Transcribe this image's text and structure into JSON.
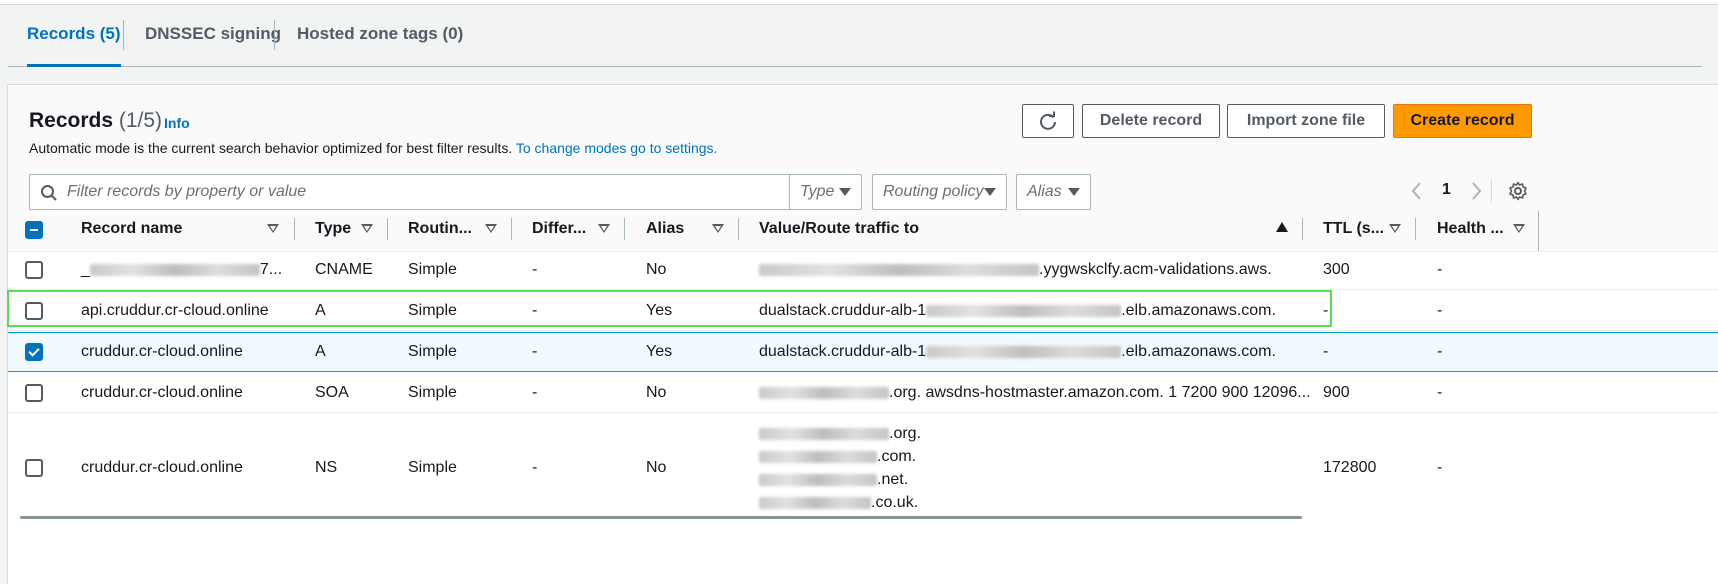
{
  "tabs": [
    {
      "label": "Records (5)"
    },
    {
      "label": "DNSSEC signing"
    },
    {
      "label": "Hosted zone tags (0)"
    }
  ],
  "header": {
    "title": "Records",
    "count": "(1/5)",
    "info": "Info",
    "description": "Automatic mode is the current search behavior optimized for best filter results.",
    "description_link": "To change modes go to settings."
  },
  "buttons": {
    "delete": "Delete record",
    "import": "Import zone file",
    "create": "Create record"
  },
  "filters": {
    "search_placeholder": "Filter records by property or value",
    "type": "Type",
    "routing_policy": "Routing policy",
    "alias": "Alias"
  },
  "pagination": {
    "page": "1"
  },
  "columns": {
    "record_name": "Record name",
    "type": "Type",
    "routing": "Routin...",
    "differ": "Differ...",
    "alias": "Alias",
    "value": "Value/Route traffic to",
    "ttl": "TTL (s...",
    "health": "Health ..."
  },
  "rows": [
    {
      "name_suffix": "7...",
      "type": "CNAME",
      "routing": "Simple",
      "differ": "-",
      "alias": "No",
      "value_suffix": ".yygwskclfy.acm-validations.aws.",
      "ttl": "300",
      "health": "-"
    },
    {
      "name": "api.cruddur.cr-cloud.online",
      "type": "A",
      "routing": "Simple",
      "differ": "-",
      "alias": "Yes",
      "value_prefix": "dualstack.cruddur-alb-1",
      "value_suffix": ".elb.amazonaws.com.",
      "ttl": "-",
      "health": "-"
    },
    {
      "name": "cruddur.cr-cloud.online",
      "type": "A",
      "routing": "Simple",
      "differ": "-",
      "alias": "Yes",
      "value_prefix": "dualstack.cruddur-alb-1",
      "value_suffix": ".elb.amazonaws.com.",
      "ttl": "-",
      "health": "-"
    },
    {
      "name": "cruddur.cr-cloud.online",
      "type": "SOA",
      "routing": "Simple",
      "differ": "-",
      "alias": "No",
      "value_suffix": ".org. awsdns-hostmaster.amazon.com. 1 7200 900 12096...",
      "ttl": "900",
      "health": "-"
    },
    {
      "name": "cruddur.cr-cloud.online",
      "type": "NS",
      "routing": "Simple",
      "differ": "-",
      "alias": "No",
      "value_lines": [
        ".org.",
        ".com.",
        ".net.",
        ".co.uk."
      ],
      "ttl": "172800",
      "health": "-"
    }
  ],
  "colors": {
    "accent": "#0073bb",
    "primary_button": "#ff9900",
    "highlight": "#55dd55"
  }
}
